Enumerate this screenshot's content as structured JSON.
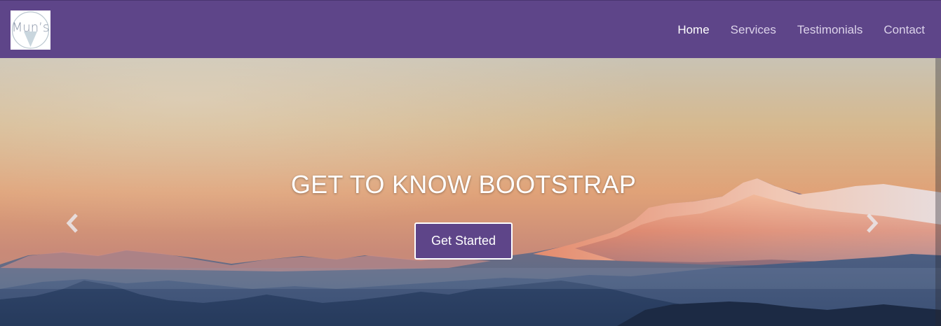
{
  "brand": {
    "logo_text": "Mun’s"
  },
  "nav": {
    "items": [
      {
        "label": "Home",
        "active": true
      },
      {
        "label": "Services",
        "active": false
      },
      {
        "label": "Testimonials",
        "active": false
      },
      {
        "label": "Contact",
        "active": false
      }
    ]
  },
  "hero": {
    "heading": "GET TO KNOW BOOTSTRAP",
    "cta_label": "Get Started",
    "prev_icon": "chevron-left-icon",
    "next_icon": "chevron-right-icon"
  },
  "colors": {
    "navbar": "#5e4589",
    "button": "#5e4589",
    "button_border": "#ffffff"
  }
}
